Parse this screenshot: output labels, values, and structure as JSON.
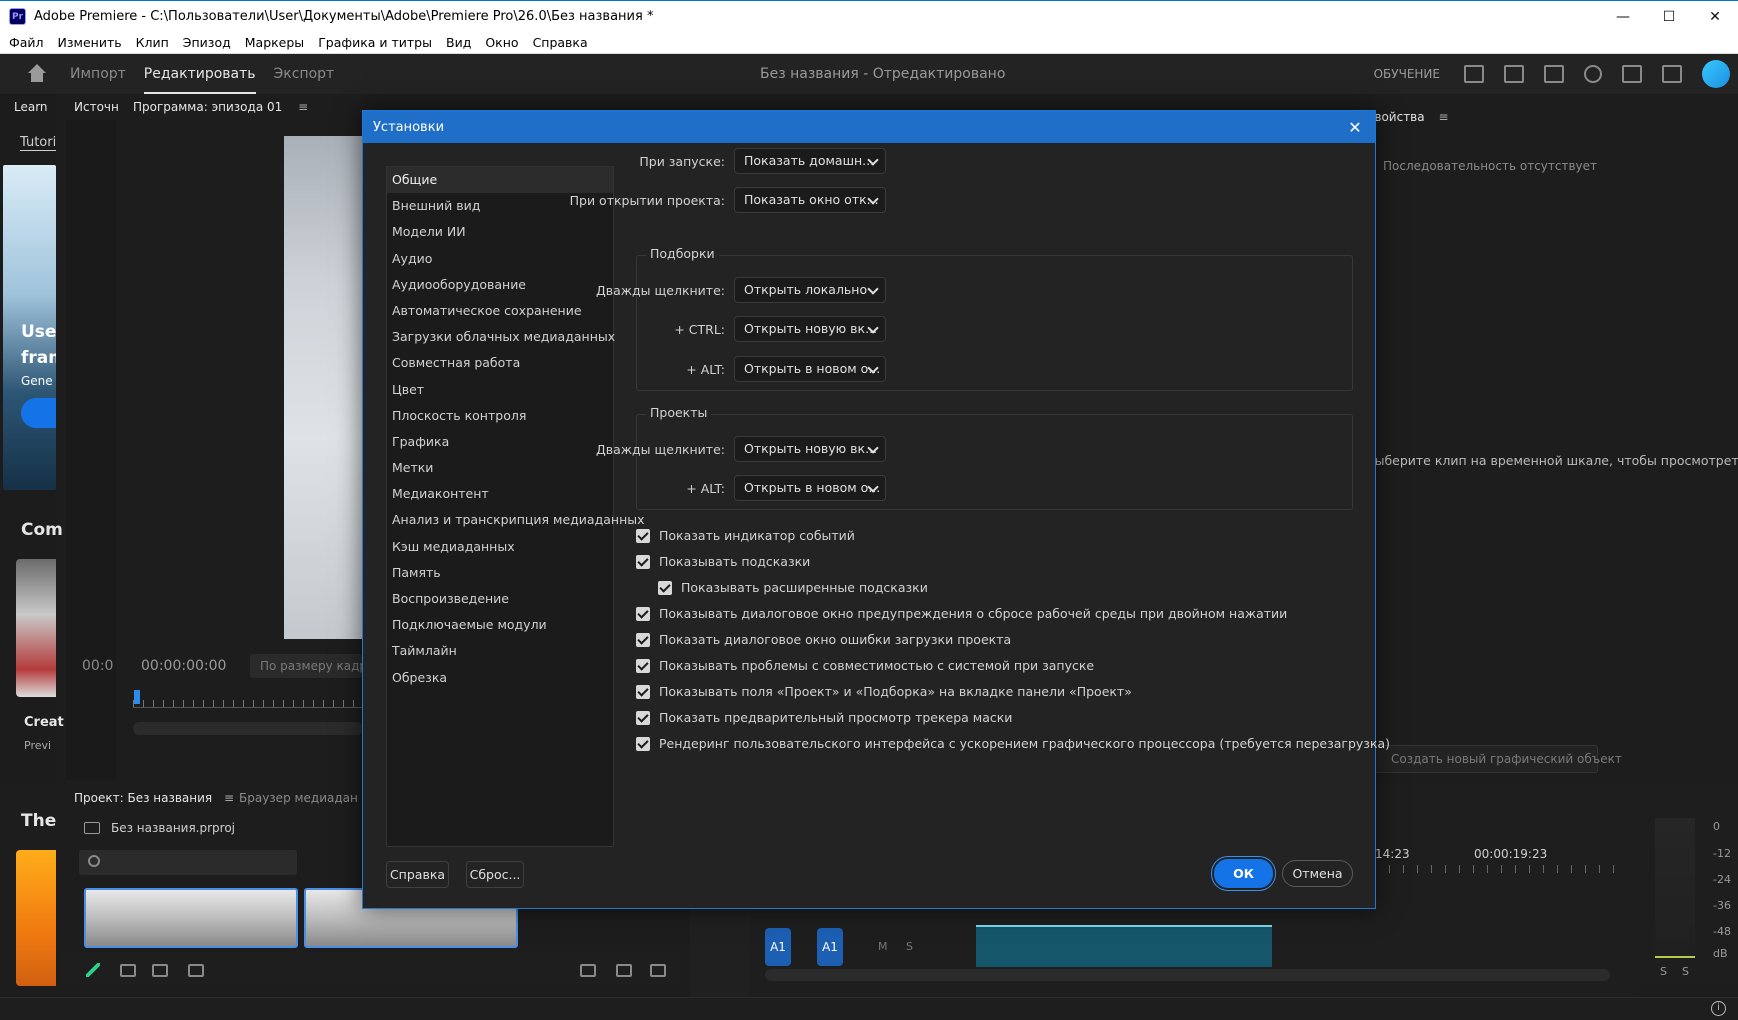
{
  "window": {
    "app_icon": "Pr",
    "title": "Adobe Premiere - C:\\Пользователи\\User\\Документы\\Adobe\\Premiere Pro\\26.0\\Без названия *",
    "minimize": "—",
    "maximize": "☐",
    "close": "✕"
  },
  "menubar": [
    "Файл",
    "Изменить",
    "Клип",
    "Эпизод",
    "Маркеры",
    "Графика и титры",
    "Вид",
    "Окно",
    "Справка"
  ],
  "header": {
    "tabs": [
      "Импорт",
      "Редактировать",
      "Экспорт"
    ],
    "active_tab": "Редактировать",
    "doc_title": "Без названия - Отредактировано",
    "learn_label": "ОБУЧЕНИЕ"
  },
  "learn_panel": {
    "tab": "Learn",
    "tutorials": "Tutori",
    "card_title_1": "Use",
    "card_title_2": "fram",
    "card_sub": "Gene",
    "section_2": "Com",
    "card2_title": "Creat",
    "card2_sub": "Previ",
    "section_3": "The"
  },
  "source_panel": {
    "tab": "Источни"
  },
  "program_panel": {
    "tab": "Программа: эпизода 01",
    "menu": "≡",
    "timecode_left": "00:0",
    "timecode": "00:00:00:00",
    "fit": "По размеру кадра"
  },
  "project_panel": {
    "tab": "Проект: Без названия",
    "menu": "≡",
    "media_browser_tab": "Браузер медиаданных",
    "file_name": "Без названия.prproj"
  },
  "properties_panel": {
    "tab": "Свойства",
    "menu": "≡",
    "empty": "Последовательность отсутствует",
    "hint": "Выберите клип на временной шкале, чтобы просмотреть свойства.",
    "new_graphic": "Создать новый графический объект"
  },
  "timeline": {
    "tc1": "14:23",
    "tc2": "00:00:19:23",
    "track_a1_src": "A1",
    "track_a1": "A1",
    "mute": "M",
    "solo": "S"
  },
  "meters": {
    "labels": [
      "0",
      "-12",
      "-24",
      "-36",
      "-48",
      "dB"
    ],
    "s1": "S",
    "s2": "S"
  },
  "dialog": {
    "title": "Установки",
    "close": "✕",
    "categories": [
      "Общие",
      "Внешний вид",
      "Модели ИИ",
      "Аудио",
      "Аудиооборудование",
      "Автоматическое сохранение",
      "Загрузки облачных медиаданных",
      "Совместная работа",
      "Цвет",
      "Плоскость контроля",
      "Графика",
      "Метки",
      "Медиаконтент",
      "Анализ и транскрипция медиаданных",
      "Кэш медиаданных",
      "Память",
      "Воспроизведение",
      "Подключаемые модули",
      "Таймлайн",
      "Обрезка"
    ],
    "selected_category": "Общие",
    "on_start_label": "При запуске:",
    "on_start_value": "Показать домашн...",
    "on_open_label": "При открытии проекта:",
    "on_open_value": "Показать окно отк...",
    "bins": {
      "title": "Подборки",
      "dbl_label": "Дважды щелкните:",
      "dbl_value": "Открыть локально",
      "ctrl_label": "+ CTRL:",
      "ctrl_value": "Открыть новую вк...",
      "alt_label": "+ ALT:",
      "alt_value": "Открыть в новом о..."
    },
    "projects": {
      "title": "Проекты",
      "dbl_label": "Дважды щелкните:",
      "dbl_value": "Открыть новую вк...",
      "alt_label": "+ ALT:",
      "alt_value": "Открыть в новом о..."
    },
    "checkboxes": [
      "Показать индикатор событий",
      "Показывать подсказки",
      "Показывать расширенные подсказки",
      "Показывать диалоговое окно предупреждения о сбросе рабочей среды при двойном нажатии",
      "Показать диалоговое окно ошибки загрузки проекта",
      "Показывать проблемы с совместимостью с системой при запуске",
      "Показывать поля «Проект» и «Подборка» на вкладке панели «Проект»",
      "Показать предварительный просмотр трекера маски",
      "Рендеринг пользовательского интерфейса с ускорением графического процессора (требуется перезагрузка)"
    ],
    "help_button": "Справка",
    "reset_button": "Сброс...",
    "ok_button": "ОК",
    "cancel_button": "Отмена"
  },
  "status": {
    "info": "i"
  }
}
